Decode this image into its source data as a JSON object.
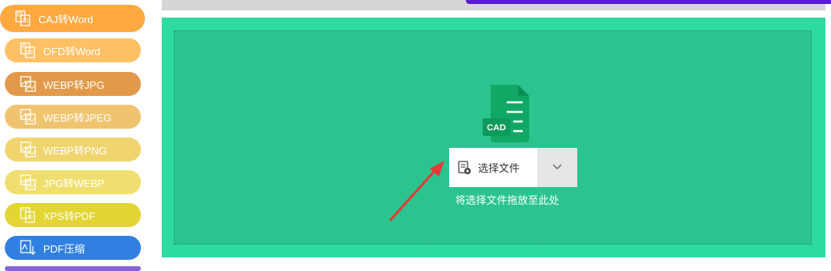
{
  "sidebar": {
    "items": [
      {
        "label": "CAJ转Word",
        "icon": "document-convert-icon",
        "color": "#FFA940"
      },
      {
        "label": "OFD转Word",
        "icon": "document-convert-icon",
        "color": "#FFC164"
      },
      {
        "label": "WEBP转JPG",
        "icon": "image-convert-icon",
        "color": "#E29A4A"
      },
      {
        "label": "WEBP转JPEG",
        "icon": "image-convert-icon",
        "color": "#F0C46E"
      },
      {
        "label": "WEBP转PNG",
        "icon": "image-convert-icon",
        "color": "#F0D56E"
      },
      {
        "label": "JPG转WEBP",
        "icon": "image-convert-icon",
        "color": "#F0DF6E"
      },
      {
        "label": "XPS转PDF",
        "icon": "document-convert-icon",
        "color": "#E2D534"
      },
      {
        "label": "PDF压缩",
        "icon": "compress-icon",
        "color": "#2F80E0"
      }
    ],
    "peek_color": "#8A63D2"
  },
  "colors": {
    "panel_bg": "#2EDB9E",
    "dropzone_bg": "#2BC48E",
    "cad_icon": "#11A866",
    "top_bar": "#5B1BD0",
    "arrow": "#E53935"
  },
  "upload": {
    "file_badge": "CAD",
    "select_label": "选择文件",
    "select_icon": "file-add-icon",
    "dropdown_icon": "chevron-down-icon",
    "hint": "将选择文件拖放至此处"
  }
}
